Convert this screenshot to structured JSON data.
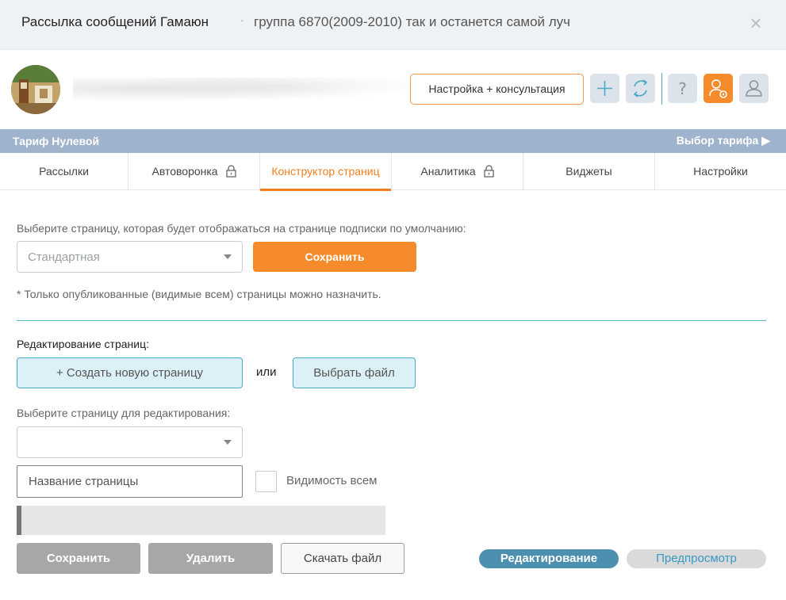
{
  "titlebar": {
    "title": "Рассылка сообщений Гамаюн",
    "separator": "·",
    "subtitle": "группа 6870(2009-2010) так и останется самой луч",
    "close_glyph": "×"
  },
  "header": {
    "consult_button": "Настройка + консультация",
    "icons": [
      "plus-icon",
      "refresh-icon",
      "help-icon",
      "settings-user-icon",
      "user-icon"
    ],
    "accent_color": "#f68b2c",
    "tariff_label": "Тариф Нулевой",
    "choose_tariff": "Выбор тарифа ▶"
  },
  "tabs": [
    {
      "label": "Рассылки",
      "locked": false,
      "active": false
    },
    {
      "label": "Автоворонка",
      "locked": true,
      "active": false
    },
    {
      "label": "Конструктор страниц",
      "locked": false,
      "active": true
    },
    {
      "label": "Аналитика",
      "locked": true,
      "active": false
    },
    {
      "label": "Виджеты",
      "locked": false,
      "active": false
    },
    {
      "label": "Настройки",
      "locked": false,
      "active": false
    }
  ],
  "default_page": {
    "label": "Выберите страницу, которая будет отображаться на странице подписки по умолчанию:",
    "select_value": "Стандартная",
    "save_button": "Сохранить",
    "note": "* Только опубликованные (видимые всем) страницы можно назначить."
  },
  "editing": {
    "label": "Редактирование страниц:",
    "create_button": "+ Создать новую страницу",
    "or_text": "или",
    "choose_file_button": "Выбрать файл",
    "select_label": "Выберите страницу для редактирования:",
    "select_value": "",
    "name_placeholder": "Название страницы",
    "visibility_label": "Видимость всем",
    "visibility_checked": false
  },
  "actions": {
    "save": "Сохранить",
    "delete": "Удалить",
    "download": "Скачать файл",
    "mode_edit": "Редактирование",
    "mode_preview": "Предпросмотр"
  }
}
